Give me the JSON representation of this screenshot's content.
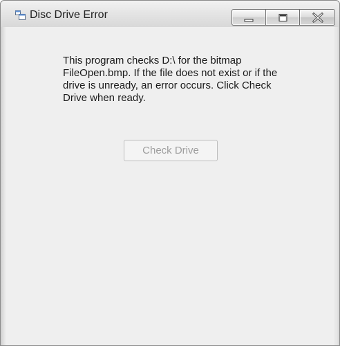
{
  "window": {
    "title": "Disc Drive Error"
  },
  "message": "This program checks D:\\ for the bitmap FileOpen.bmp. If the file does not exist or if the drive is unready, an error occurs. Click Check Drive when ready.",
  "check_drive_button": {
    "label": "Check Drive",
    "enabled": false
  },
  "icons": {
    "app": "form-window-icon",
    "minimize": "minimize-icon",
    "maximize": "maximize-icon",
    "close": "close-icon"
  },
  "colors": {
    "client_background": "#efefef",
    "disabled_text": "#9e9e9e"
  }
}
